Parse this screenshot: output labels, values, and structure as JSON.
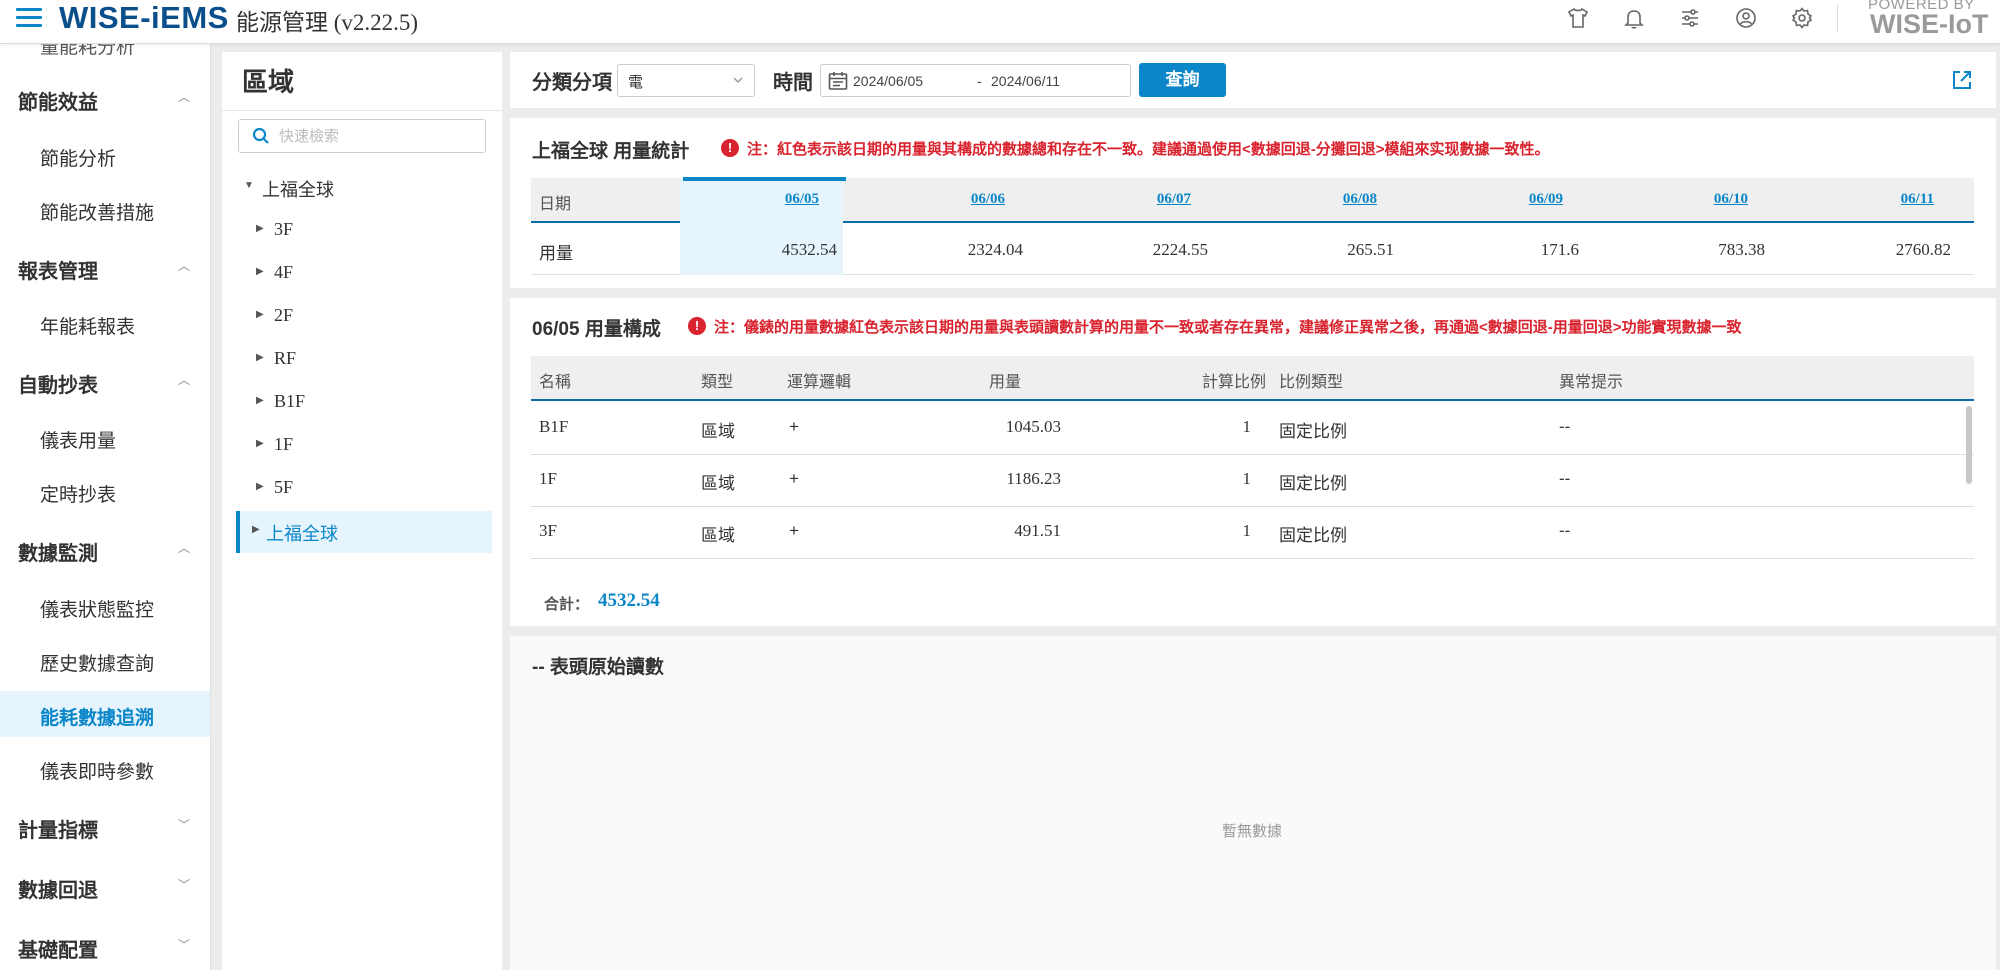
{
  "header": {
    "brand": "WISE-iEMS",
    "app_title": "能源管理 (v2.22.5)",
    "powered_by": "POWERED BY",
    "powered_brand": "WISE-IoT",
    "icons": [
      "shirt-icon",
      "bell-icon",
      "sliders-icon",
      "user-circle-icon",
      "gear-icon"
    ]
  },
  "sidebar": {
    "cut_item": "量能耗分析",
    "groups": [
      {
        "label": "節能效益",
        "expanded": true,
        "items": [
          "節能分析",
          "節能改善措施"
        ]
      },
      {
        "label": "報表管理",
        "expanded": true,
        "items": [
          "年能耗報表"
        ]
      },
      {
        "label": "自動抄表",
        "expanded": true,
        "items": [
          "儀表用量",
          "定時抄表"
        ]
      },
      {
        "label": "數據監測",
        "expanded": true,
        "items": [
          "儀表狀態監控",
          "歷史數據查詢",
          "能耗數據追溯",
          "儀表即時參數"
        ]
      },
      {
        "label": "計量指標",
        "expanded": false,
        "items": []
      },
      {
        "label": "數據回退",
        "expanded": false,
        "items": []
      },
      {
        "label": "基礎配置",
        "expanded": false,
        "items": []
      }
    ],
    "active_item": "能耗數據追溯"
  },
  "tree": {
    "title": "區域",
    "search_placeholder": "快速檢索",
    "root": "上福全球",
    "children": [
      "3F",
      "4F",
      "2F",
      "RF",
      "B1F",
      "1F",
      "5F",
      "上福全球"
    ],
    "selected": "上福全球"
  },
  "filters": {
    "category_label": "分類分項",
    "category_value": "電",
    "time_label": "時間",
    "date_start": "2024/06/05",
    "date_sep": "-",
    "date_end": "2024/06/11",
    "query_button": "查詢"
  },
  "stats": {
    "title": "上福全球 用量統計",
    "warning": "注：紅色表示該日期的用量與其構成的數據總和存在不一致。建議通過使用<數據回退-分攤回退>模組來实现數據一致性。",
    "row_header_date": "日期",
    "row_header_usage": "用量",
    "dates": [
      "06/05",
      "06/06",
      "06/07",
      "06/08",
      "06/09",
      "06/10",
      "06/11"
    ],
    "values": [
      "4532.54",
      "2324.04",
      "2224.55",
      "265.51",
      "171.6",
      "783.38",
      "2760.82"
    ],
    "selected_date": "06/05"
  },
  "composition": {
    "title": "06/05 用量構成",
    "warning": "注：儀錶的用量數據紅色表示該日期的用量與表頭讀數計算的用量不一致或者存在異常，建議修正異常之後，再通過<數據回退-用量回退>功能實現數據一致",
    "columns": [
      "名稱",
      "類型",
      "運算邏輯",
      "用量",
      "計算比例",
      "比例類型",
      "異常提示"
    ],
    "rows": [
      {
        "name": "B1F",
        "type": "區域",
        "op": "+",
        "usage": "1045.03",
        "ratio": "1",
        "ratio_type": "固定比例",
        "alert": "--"
      },
      {
        "name": "1F",
        "type": "區域",
        "op": "+",
        "usage": "1186.23",
        "ratio": "1",
        "ratio_type": "固定比例",
        "alert": "--"
      },
      {
        "name": "3F",
        "type": "區域",
        "op": "+",
        "usage": "491.51",
        "ratio": "1",
        "ratio_type": "固定比例",
        "alert": "--"
      }
    ],
    "total_label": "合計：",
    "total_value": "4532.54"
  },
  "raw_readings": {
    "title": "-- 表頭原始讀數",
    "empty_text": "暫無數據"
  },
  "colors": {
    "accent": "#0a86c9",
    "brand": "#0a4f8c",
    "warning": "#d9232e",
    "selected_bg": "#e6f5fd"
  }
}
